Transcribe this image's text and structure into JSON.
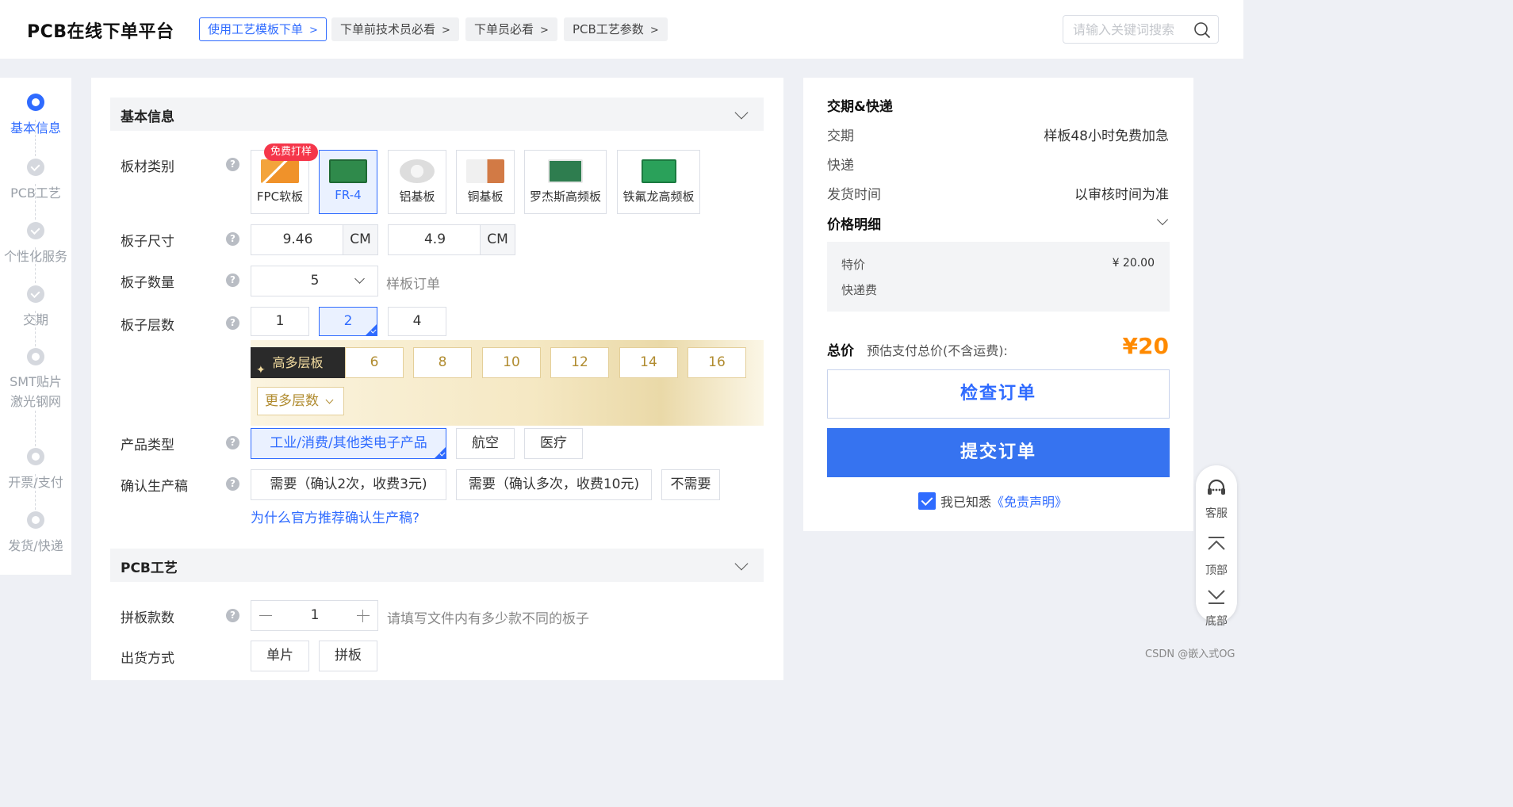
{
  "header": {
    "brand": "PCB在线下单平台",
    "tags": [
      {
        "label": "使用工艺模板下单",
        "chev": ">"
      },
      {
        "label": "下单前技术员必看",
        "chev": ">"
      },
      {
        "label": "下单员必看",
        "chev": ">"
      },
      {
        "label": "PCB工艺参数",
        "chev": ">"
      }
    ],
    "search_placeholder": "请输入关键词搜索"
  },
  "steps": [
    {
      "label": "基本信息",
      "state": "active"
    },
    {
      "label": "PCB工艺",
      "state": "done"
    },
    {
      "label": "个性化服务",
      "state": "done"
    },
    {
      "label": "交期",
      "state": "done"
    },
    {
      "label_line1": "SMT贴片",
      "label_line2": "激光钢网",
      "state": "todo"
    },
    {
      "label": "开票/支付",
      "state": "todo"
    },
    {
      "label": "发货/快递",
      "state": "todo"
    }
  ],
  "basic": {
    "section_title": "基本信息",
    "material_label": "板材类别",
    "free_badge": "免费打样",
    "materials": [
      "FPC软板",
      "FR-4",
      "铝基板",
      "铜基板",
      "罗杰斯高频板",
      "铁氟龙高频板"
    ],
    "material_selected": "FR-4",
    "size_label": "板子尺寸",
    "size_w": "9.46",
    "size_h": "4.9",
    "size_unit": "CM",
    "qty_label": "板子数量",
    "qty_value": "5",
    "qty_hint": "样板订单",
    "layers_label": "板子层数",
    "layers": [
      "1",
      "2",
      "4"
    ],
    "layer_selected": "2",
    "high_layer_tag": "高多层板",
    "high_layers": [
      "6",
      "8",
      "10",
      "12",
      "14",
      "16"
    ],
    "more_layers": "更多层数",
    "product_label": "产品类型",
    "products": [
      "工业/消费/其他类电子产品",
      "航空",
      "医疗"
    ],
    "product_selected": "工业/消费/其他类电子产品",
    "confirm_label": "确认生产稿",
    "confirm_options": [
      "需要（确认2次，收费3元)",
      "需要（确认多次，收费10元)",
      "不需要"
    ],
    "confirm_link": "为什么官方推荐确认生产稿?"
  },
  "pcb": {
    "section_title": "PCB工艺",
    "panel_label": "拼板款数",
    "panel_value": "1",
    "panel_hint": "请填写文件内有多少款不同的板子",
    "ship_label": "出货方式",
    "ship_options": [
      "单片",
      "拼板"
    ]
  },
  "summary": {
    "title": "交期&快递",
    "rows": [
      {
        "label": "交期",
        "value": "样板48小时免费加急"
      },
      {
        "label": "快递",
        "value": ""
      },
      {
        "label": "发货时间",
        "value": "以审核时间为准"
      }
    ],
    "price_title": "价格明细",
    "price_items": [
      {
        "label": "特价",
        "value": "¥ 20.00"
      },
      {
        "label": "快递费",
        "value": ""
      }
    ],
    "total_label": "总价",
    "total_sub": "预估支付总价(不含运费):",
    "total_value": "¥20",
    "check_button": "检查订单",
    "submit_button": "提交订单",
    "agree_text": "我已知悉",
    "agree_link": "《免责声明》"
  },
  "float": {
    "service": "客服",
    "top": "顶部",
    "bottom": "底部"
  },
  "watermark": "CSDN @嵌入式OG",
  "colors": {
    "accent": "#2f6bff",
    "gold": "#b08b2f",
    "price": "#ff8a00"
  }
}
